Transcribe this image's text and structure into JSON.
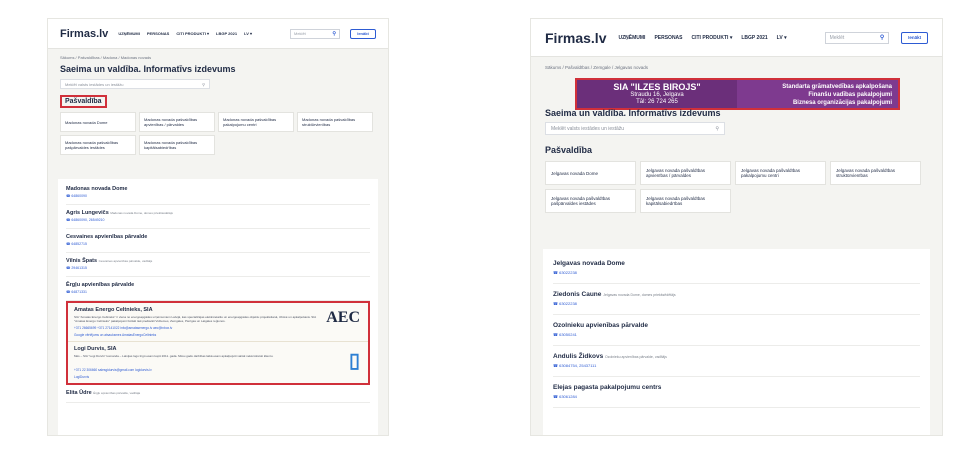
{
  "left": {
    "header": {
      "logo": "Firmas.lv",
      "nav": [
        "UZŅĒMUMI",
        "PERSONAS",
        "CITI PRODUKTI ▾",
        "LBGP 2021",
        "LV ▾"
      ],
      "search_placeholder": "Meklēt",
      "login": "Ienākt"
    },
    "breadcrumb": "Sākums / Pašvaldības / Madona / Madonas novads",
    "title": "Saeima un valdība. Informatīvs izdevums",
    "inst_search_placeholder": "Meklēt valsts iestādes un iestāžu",
    "section": "Pašvaldība",
    "cards": [
      "Madonas novada Dome",
      "Madonas novada pašvaldības apvienības / pārvaldes",
      "Madonas novada pašvaldības pakalpojumu centri",
      "Madonas novada pašvaldības struktūrvienības",
      "Madonas novada pašvaldības pašpārvaldes iestādes",
      "Madonas novada pašvaldības kapitālsabiedrības"
    ],
    "items": [
      {
        "name": "Madonas novada Dome",
        "sub": "",
        "phone": "64860090"
      },
      {
        "name": "Agris Lungevičs",
        "sub": "Madonas novada Dome, domes priekšsēdētājs",
        "phone": "64860090, 26549210"
      },
      {
        "name": "Cesvaines apvienības pārvalde",
        "sub": "",
        "phone": "64852715"
      },
      {
        "name": "Vilnis Špats",
        "sub": "Cesvaines apvienības pārvalde, vadītājs",
        "phone": "29461315"
      },
      {
        "name": "Ērgļu apvienības pārvalde",
        "sub": "",
        "phone": "64871331"
      }
    ],
    "ads": [
      {
        "name": "Amatas Energo Celtnieks, SIA",
        "text": "SIA \"Amatas Energo Celtnieks\" ir viena no energoapgādes uzņēmumiem Latvijā, kas specializējas elektroietaišu un energoapgādes objektu projektēšanā, izbūvē un apkalpošanā. SIA \"Amatas Energo Celtnieks\" pakalpojumi būtiski tiek piedāvāti Vidzemes, Zemgales, Pierīgas un Latgales reģionos.",
        "contacts": "+371 26665699  +371 27141022  info@amatasenergo.lv  aec@inbox.lv",
        "links": "Google vērtējums un atsauksmes   AmatasEnergoCeltnieks",
        "logo": "AEC"
      },
      {
        "name": "Logi Durvis, SIA",
        "text": "Mēs – SIA \"Logi Durvis\" komanda – Latvijas logu tirgū esam kopš 2011. gada. Mūsu gadu darbības laikā esam apkalpojuši vairāk nekā tūkstoti klientu.",
        "contacts": "+371 22 306660  salesgidurvis@gmail.com  logidurvis.lv",
        "links": "LogiDurvis",
        "logo": "▯"
      }
    ],
    "last_item": {
      "name": "Elita Ūdre",
      "sub": "Ērgļu apvienības pārvalde, vadītāja"
    }
  },
  "right": {
    "header": {
      "logo": "Firmas.lv",
      "nav": [
        "UZŅĒMUMI",
        "PERSONAS",
        "CITI PRODUKTI ▾",
        "LBGP 2021",
        "LV ▾"
      ],
      "search_placeholder": "Meklēt",
      "login": "Ienākt"
    },
    "breadcrumb": "Sākums / Pašvaldības / Zemgale / Jelgavas novads",
    "banner": {
      "title": "SIA \"ILZES BIROJS\"",
      "line1": "Straudu 16, Jelgava",
      "line2": "Tāl: 26 724 265",
      "r1": "Standarta grāmatvedības apkalpošana",
      "r2": "Finanšu vadības pakalpojumi",
      "r3": "Biznesa organizācijas pakalpojumi"
    },
    "title": "Saeima un valdība. Informatīvs izdevums",
    "inst_search_placeholder": "Meklēt valsts iestādes un iestāžu",
    "section": "Pašvaldība",
    "cards": [
      "Jelgavas novada Dome",
      "Jelgavas novada pašvaldības apvienības / pārvaldes",
      "Jelgavas novada pašvaldības pakalpojumu centri",
      "Jelgavas novada pašvaldības struktūrvienības",
      "Jelgavas novada pašvaldības pašpārvaldes iestādes",
      "Jelgavas novada pašvaldības kapitālsabiedrības"
    ],
    "items": [
      {
        "name": "Jelgavas novada Dome",
        "sub": "",
        "phone": "63022238"
      },
      {
        "name": "Ziedonis Caune",
        "sub": "Jelgavas novada Dome, domes priekšsēdētājs",
        "phone": "63022238"
      },
      {
        "name": "Ozolnieku apvienības pārvalde",
        "sub": "",
        "phone": "63050241"
      },
      {
        "name": "Andulis Židkovs",
        "sub": "Ozolnieku apvienības pārvalde, vadītājs",
        "phone": "63084754, 25437111"
      },
      {
        "name": "Elejas pagasta pakalpojumu centrs",
        "sub": "",
        "phone": "63061284"
      }
    ]
  }
}
